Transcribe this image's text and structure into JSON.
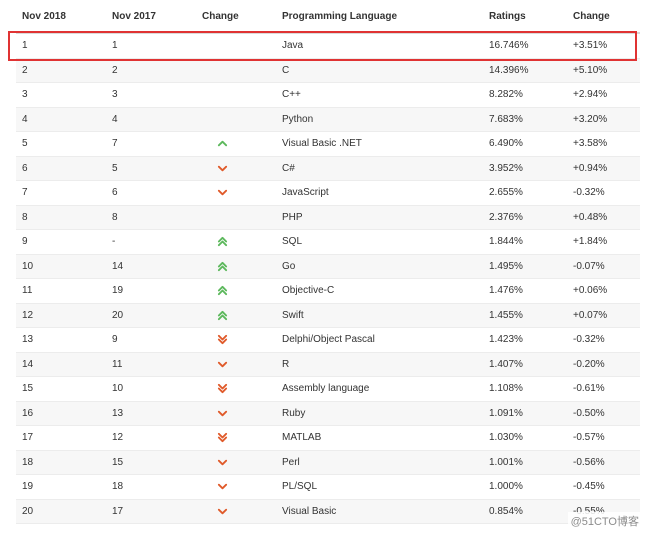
{
  "header": {
    "col1": "Nov 2018",
    "col2": "Nov 2017",
    "col3": "Change",
    "col4": "Programming Language",
    "col5": "Ratings",
    "col6": "Change"
  },
  "rows": [
    {
      "rank2018": "1",
      "rank2017": "1",
      "change": "none",
      "language": "Java",
      "rating": "16.746%",
      "delta": "+3.51%"
    },
    {
      "rank2018": "2",
      "rank2017": "2",
      "change": "none",
      "language": "C",
      "rating": "14.396%",
      "delta": "+5.10%"
    },
    {
      "rank2018": "3",
      "rank2017": "3",
      "change": "none",
      "language": "C++",
      "rating": "8.282%",
      "delta": "+2.94%"
    },
    {
      "rank2018": "4",
      "rank2017": "4",
      "change": "none",
      "language": "Python",
      "rating": "7.683%",
      "delta": "+3.20%"
    },
    {
      "rank2018": "5",
      "rank2017": "7",
      "change": "up",
      "language": "Visual Basic .NET",
      "rating": "6.490%",
      "delta": "+3.58%"
    },
    {
      "rank2018": "6",
      "rank2017": "5",
      "change": "down",
      "language": "C#",
      "rating": "3.952%",
      "delta": "+0.94%"
    },
    {
      "rank2018": "7",
      "rank2017": "6",
      "change": "down",
      "language": "JavaScript",
      "rating": "2.655%",
      "delta": "-0.32%"
    },
    {
      "rank2018": "8",
      "rank2017": "8",
      "change": "none",
      "language": "PHP",
      "rating": "2.376%",
      "delta": "+0.48%"
    },
    {
      "rank2018": "9",
      "rank2017": "-",
      "change": "double-up",
      "language": "SQL",
      "rating": "1.844%",
      "delta": "+1.84%"
    },
    {
      "rank2018": "10",
      "rank2017": "14",
      "change": "double-up",
      "language": "Go",
      "rating": "1.495%",
      "delta": "-0.07%"
    },
    {
      "rank2018": "11",
      "rank2017": "19",
      "change": "double-up",
      "language": "Objective-C",
      "rating": "1.476%",
      "delta": "+0.06%"
    },
    {
      "rank2018": "12",
      "rank2017": "20",
      "change": "double-up",
      "language": "Swift",
      "rating": "1.455%",
      "delta": "+0.07%"
    },
    {
      "rank2018": "13",
      "rank2017": "9",
      "change": "double-down",
      "language": "Delphi/Object Pascal",
      "rating": "1.423%",
      "delta": "-0.32%"
    },
    {
      "rank2018": "14",
      "rank2017": "11",
      "change": "down",
      "language": "R",
      "rating": "1.407%",
      "delta": "-0.20%"
    },
    {
      "rank2018": "15",
      "rank2017": "10",
      "change": "double-down",
      "language": "Assembly language",
      "rating": "1.108%",
      "delta": "-0.61%"
    },
    {
      "rank2018": "16",
      "rank2017": "13",
      "change": "down",
      "language": "Ruby",
      "rating": "1.091%",
      "delta": "-0.50%"
    },
    {
      "rank2018": "17",
      "rank2017": "12",
      "change": "double-down",
      "language": "MATLAB",
      "rating": "1.030%",
      "delta": "-0.57%"
    },
    {
      "rank2018": "18",
      "rank2017": "15",
      "change": "down",
      "language": "Perl",
      "rating": "1.001%",
      "delta": "-0.56%"
    },
    {
      "rank2018": "19",
      "rank2017": "18",
      "change": "down",
      "language": "PL/SQL",
      "rating": "1.000%",
      "delta": "-0.45%"
    },
    {
      "rank2018": "20",
      "rank2017": "17",
      "change": "down",
      "language": "Visual Basic",
      "rating": "0.854%",
      "delta": "-0.55%"
    }
  ],
  "icons": {
    "up": "chevron-up-icon",
    "double-up": "double-chevron-up-icon",
    "down": "chevron-down-icon",
    "double-down": "double-chevron-down-icon"
  },
  "colors": {
    "up": "#5cb85c",
    "down": "#e05a2a",
    "highlight": "#e03333"
  },
  "watermark": "@51CTO博客"
}
